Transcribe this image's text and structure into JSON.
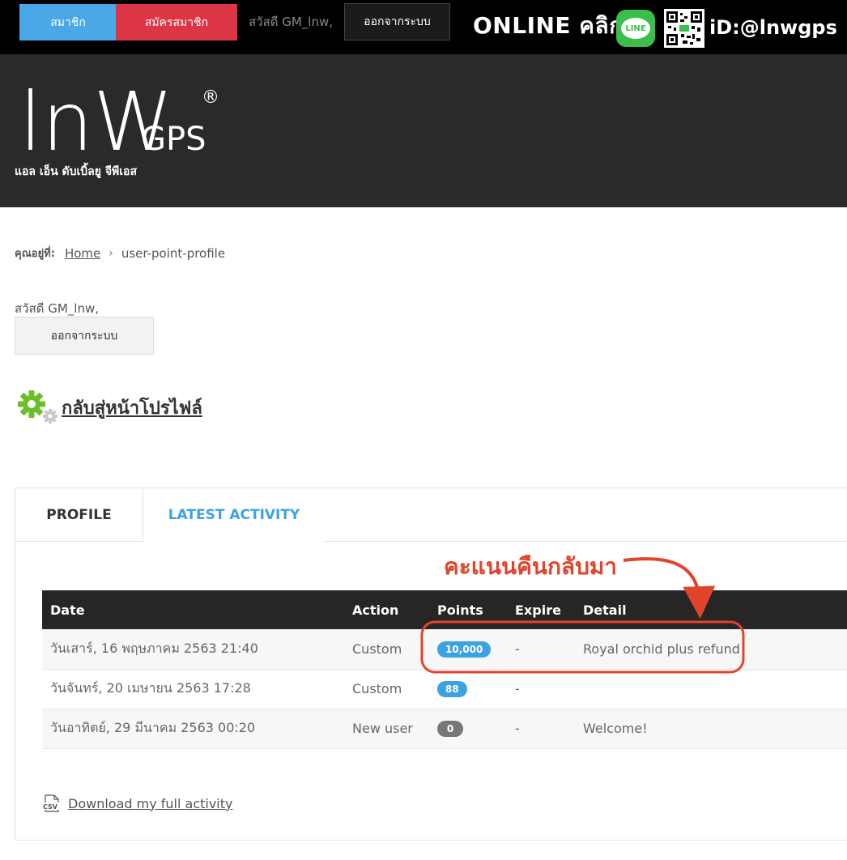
{
  "topbar": {
    "member_label": "สมาชิก",
    "register_label": "สมัครสมาชิก",
    "greeting": "สวัสดี GM_lnw,",
    "logout_label": "ออกจากระบบ",
    "online_text": "ONLINE คลิก",
    "line_badge": "LINE",
    "line_id": "iD:@lnwgps"
  },
  "header": {
    "logo_main": "lnW",
    "logo_gps": "GPS",
    "logo_reg": "®",
    "logo_subtitle": "แอล เอ็น ดับเบิ้ลยู จีพีเอส"
  },
  "breadcrumb": {
    "label": "คุณอยู่ที่:",
    "home": "Home",
    "separator": "›",
    "current": "user-point-profile"
  },
  "user": {
    "greeting": "สวัสดี GM_lnw,",
    "logout_label": "ออกจากระบบ"
  },
  "back_link": "กลับสู่หน้าโปรไฟล์",
  "tabs": [
    {
      "label": "PROFILE"
    },
    {
      "label": "LATEST ACTIVITY"
    }
  ],
  "annotation": {
    "text": "คะแนนคืนกลับมา",
    "color": "#e2442b"
  },
  "table": {
    "headers": [
      "Date",
      "Action",
      "Points",
      "Expire",
      "Detail"
    ],
    "rows": [
      {
        "date": "วันเสาร์, 16 พฤษภาคม 2563 21:40",
        "action": "Custom",
        "points": "10,000",
        "expire": "-",
        "detail": "Royal orchid plus refund"
      },
      {
        "date": "วันจันทร์, 20 เมษายน 2563 17:28",
        "action": "Custom",
        "points": "88",
        "expire": "-",
        "detail": ""
      },
      {
        "date": "วันอาทิตย์, 29 มีนาคม 2563 00:20",
        "action": "New user",
        "points": "0",
        "expire": "-",
        "detail": "Welcome!"
      }
    ]
  },
  "download": {
    "icon_text": "CSV",
    "label": "Download my full activity"
  },
  "colors": {
    "accent_blue": "#3ba3e2",
    "register_red": "#dc3545",
    "line_green": "#3ac04a",
    "gear_green": "#6cbf2a"
  }
}
